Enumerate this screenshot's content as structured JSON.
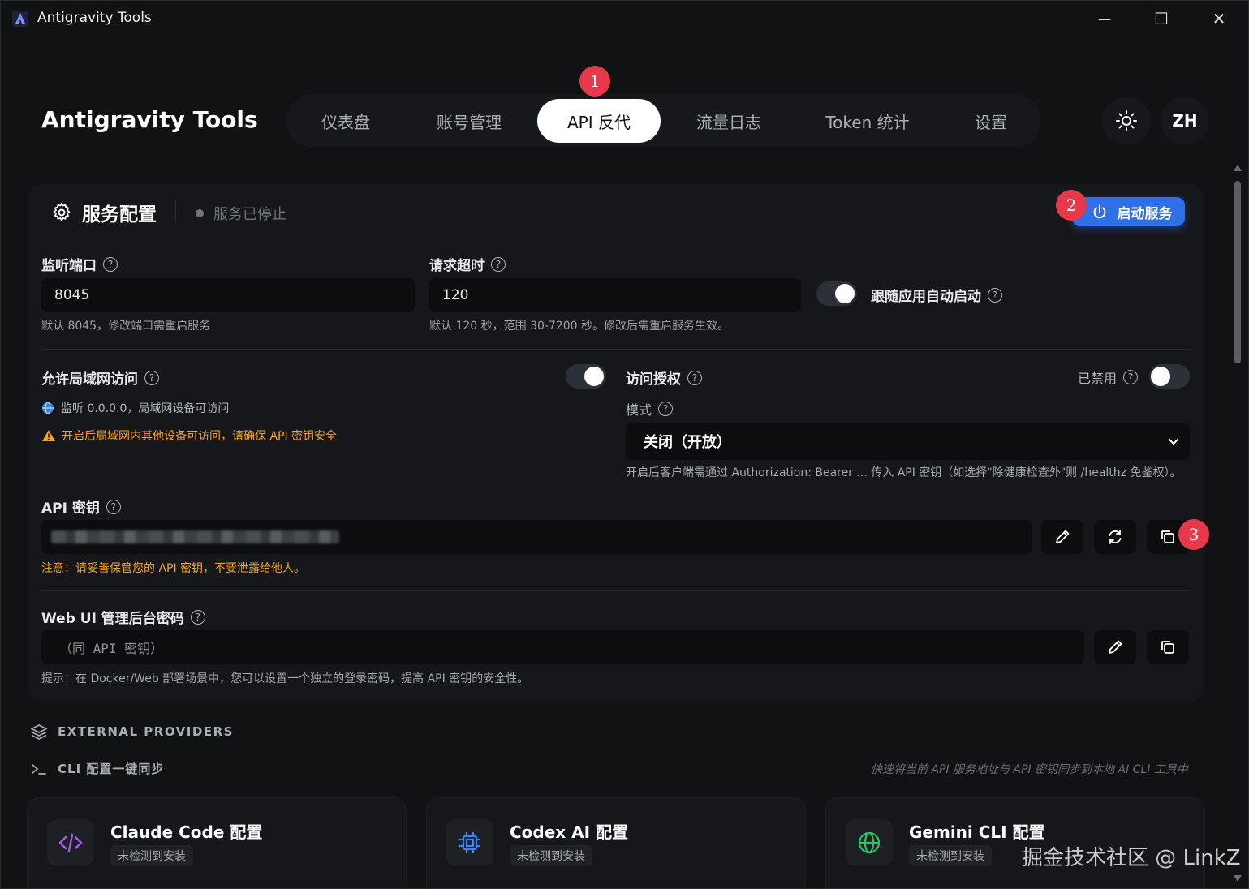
{
  "window": {
    "title": "Antigravity Tools",
    "minimize_glyph": "—",
    "maximize_glyph": "☐",
    "close_glyph": "✕"
  },
  "header": {
    "brand": "Antigravity Tools",
    "tabs": [
      {
        "label": "仪表盘",
        "active": false
      },
      {
        "label": "账号管理",
        "active": false
      },
      {
        "label": "API 反代",
        "active": true
      },
      {
        "label": "流量日志",
        "active": false
      },
      {
        "label": "Token 统计",
        "active": false
      },
      {
        "label": "设置",
        "active": false
      }
    ],
    "theme_icon": "sun-icon",
    "lang_label": "ZH"
  },
  "annotations": [
    "1",
    "2",
    "3"
  ],
  "service": {
    "title": "服务配置",
    "status": "服务已停止",
    "start_button": "启动服务",
    "port_label": "监听端口",
    "port_value": "8045",
    "port_hint": "默认 8045，修改端口需重启服务",
    "timeout_label": "请求超时",
    "timeout_value": "120",
    "timeout_hint": "默认 120 秒，范围 30-7200 秒。修改后需重启服务生效。",
    "autostart_label": "跟随应用自动启动",
    "autostart_on": true,
    "lan_label": "允许局域网访问",
    "lan_on": true,
    "lan_hint": "监听 0.0.0.0，局域网设备可访问",
    "lan_warning": "开启后局域网内其他设备可访问，请确保 API 密钥安全",
    "auth_label": "访问授权",
    "auth_state": "已禁用",
    "auth_on": false,
    "mode_label": "模式",
    "mode_value": "关闭（开放）",
    "mode_hint": "开启后客户端需通过 Authorization: Bearer ... 传入 API 密钥（如选择\"除健康检查外\"则 /healthz 免鉴权）。",
    "api_key_label": "API 密钥",
    "api_key_warning": "注意：请妥善保管您的 API 密钥，不要泄露给他人。",
    "webui_label": "Web UI 管理后台密码",
    "webui_placeholder": "（同 API 密钥）",
    "webui_hint": "提示：在 Docker/Web 部署场景中，您可以设置一个独立的登录密码，提高 API 密钥的安全性。"
  },
  "external": {
    "title": "EXTERNAL PROVIDERS",
    "cli_title": "CLI 配置一键同步",
    "cli_hint": "快速将当前 API 服务地址与 API 密钥同步到本地 AI CLI 工具中",
    "providers": [
      {
        "title": "Claude Code 配置",
        "status": "未检测到安装",
        "icon": "code-icon",
        "color": "#a45cf0"
      },
      {
        "title": "Codex AI 配置",
        "status": "未检测到安装",
        "icon": "chip-icon",
        "color": "#3b82f6"
      },
      {
        "title": "Gemini CLI 配置",
        "status": "未检测到安装",
        "icon": "globe-icon",
        "color": "#22c55e"
      }
    ]
  },
  "watermark": "掘金技术社区 @ LinkZ"
}
